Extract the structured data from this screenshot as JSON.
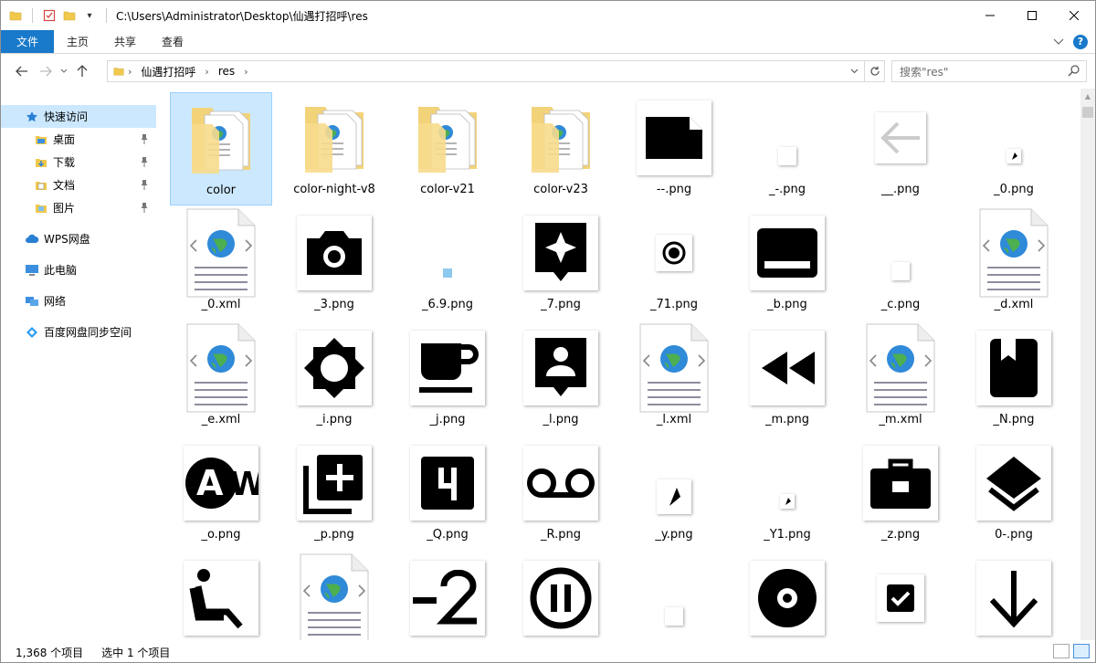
{
  "titlebar": {
    "path": "C:\\Users\\Administrator\\Desktop\\仙遇打招呼\\res",
    "quick_access_dropdown": "▾"
  },
  "ribbon": {
    "tabs": [
      "文件",
      "主页",
      "共享",
      "查看"
    ]
  },
  "address": {
    "crumbs": [
      "仙遇打招呼",
      "res"
    ],
    "search_placeholder": "搜索\"res\""
  },
  "nav": {
    "items": [
      {
        "label": "快速访问",
        "icon": "star-icon",
        "selected": true
      },
      {
        "label": "桌面",
        "icon": "desktop-folder-icon",
        "pinned": true
      },
      {
        "label": "下载",
        "icon": "download-folder-icon",
        "pinned": true
      },
      {
        "label": "文档",
        "icon": "documents-folder-icon",
        "pinned": true
      },
      {
        "label": "图片",
        "icon": "pictures-folder-icon",
        "pinned": true
      },
      {
        "label": "WPS网盘",
        "icon": "cloud-icon"
      },
      {
        "label": "此电脑",
        "icon": "computer-icon"
      },
      {
        "label": "网络",
        "icon": "network-icon"
      },
      {
        "label": "百度网盘同步空间",
        "icon": "baidu-sync-icon"
      }
    ]
  },
  "files": [
    {
      "name": "color",
      "type": "folder",
      "selected": true
    },
    {
      "name": "color-night-v8",
      "type": "folder"
    },
    {
      "name": "color-v21",
      "type": "folder"
    },
    {
      "name": "color-v23",
      "type": "folder"
    },
    {
      "name": "--.png",
      "type": "png",
      "icon": "file-corner-icon"
    },
    {
      "name": "_-.png",
      "type": "png",
      "icon": "tiny-blank-icon"
    },
    {
      "name": "__.png",
      "type": "png",
      "icon": "arrow-left-icon"
    },
    {
      "name": "_0.png",
      "type": "png",
      "icon": "tiny-star-icon"
    },
    {
      "name": "_0.xml",
      "type": "xml"
    },
    {
      "name": "_3.png",
      "type": "png",
      "icon": "camera-icon"
    },
    {
      "name": "_6.9.png",
      "type": "png",
      "icon": "tiny-dot-icon"
    },
    {
      "name": "_7.png",
      "type": "png",
      "icon": "sparkle-pin-icon"
    },
    {
      "name": "_71.png",
      "type": "png",
      "icon": "radio-button-icon"
    },
    {
      "name": "_b.png",
      "type": "png",
      "icon": "subtitles-icon"
    },
    {
      "name": "_c.png",
      "type": "png",
      "icon": "tiny-blank-icon"
    },
    {
      "name": "_d.xml",
      "type": "xml"
    },
    {
      "name": "_e.xml",
      "type": "xml"
    },
    {
      "name": "_i.png",
      "type": "png",
      "icon": "brightness-icon"
    },
    {
      "name": "_j.png",
      "type": "png",
      "icon": "coffee-icon"
    },
    {
      "name": "_l.png",
      "type": "png",
      "icon": "person-pin-icon"
    },
    {
      "name": "_l.xml",
      "type": "xml"
    },
    {
      "name": "_m.png",
      "type": "png",
      "icon": "rewind-icon"
    },
    {
      "name": "_m.xml",
      "type": "xml"
    },
    {
      "name": "_N.png",
      "type": "png",
      "icon": "book-icon"
    },
    {
      "name": "_o.png",
      "type": "png",
      "icon": "aw-logo-icon"
    },
    {
      "name": "_p.png",
      "type": "png",
      "icon": "add-to-library-icon"
    },
    {
      "name": "_Q.png",
      "type": "png",
      "icon": "digit-four-icon"
    },
    {
      "name": "_R.png",
      "type": "png",
      "icon": "voicemail-icon"
    },
    {
      "name": "_y.png",
      "type": "png",
      "icon": "small-star-icon"
    },
    {
      "name": "_Y1.png",
      "type": "png",
      "icon": "tiny-star-icon"
    },
    {
      "name": "_z.png",
      "type": "png",
      "icon": "toolbox-icon"
    },
    {
      "name": "0-.png",
      "type": "png",
      "icon": "layers-icon"
    },
    {
      "name": "",
      "type": "png",
      "icon": "seat-recline-icon"
    },
    {
      "name": "",
      "type": "xml"
    },
    {
      "name": "",
      "type": "png",
      "icon": "minus-two-icon"
    },
    {
      "name": "",
      "type": "png",
      "icon": "pause-circle-icon"
    },
    {
      "name": "",
      "type": "png",
      "icon": "tiny-blank-icon"
    },
    {
      "name": "",
      "type": "png",
      "icon": "disc-icon"
    },
    {
      "name": "",
      "type": "png",
      "icon": "checkbox-icon"
    },
    {
      "name": "",
      "type": "png",
      "icon": "arrow-down-icon"
    }
  ],
  "status": {
    "count": "1,368 个项目",
    "selection": "选中 1 个项目"
  }
}
